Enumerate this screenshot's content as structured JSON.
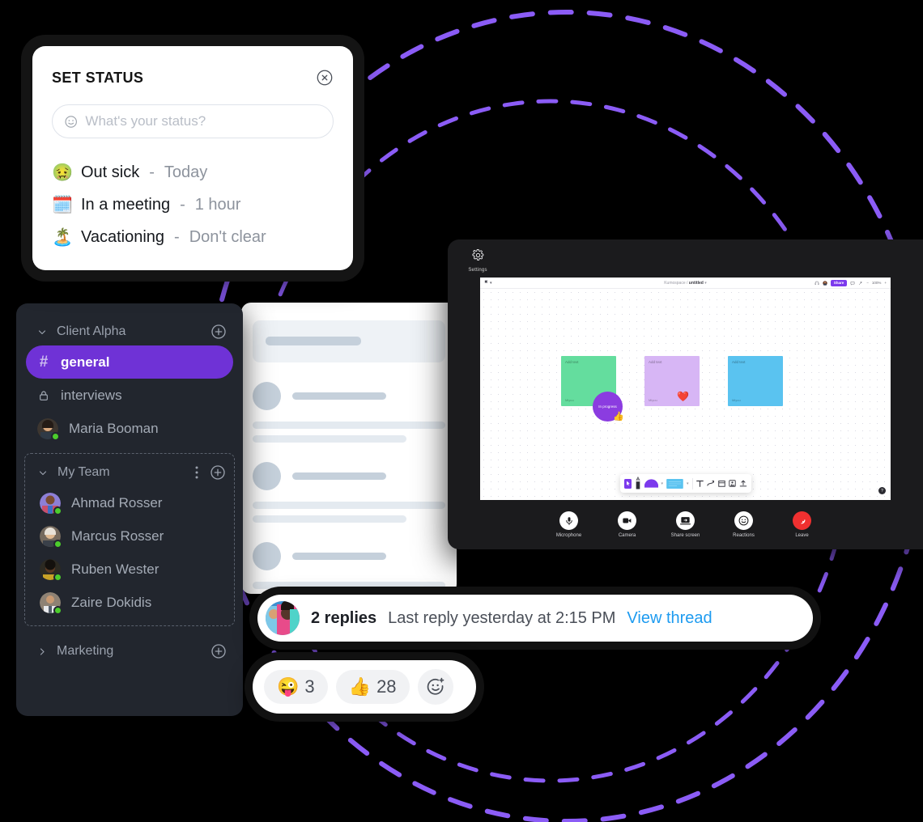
{
  "status_card": {
    "title": "SET STATUS",
    "close_icon": "close-circle-icon",
    "input": {
      "placeholder": "What's your status?",
      "value": "",
      "icon": "smiley-icon"
    },
    "options": [
      {
        "emoji": "🤢",
        "label": "Out sick",
        "dash": "-",
        "duration": "Today"
      },
      {
        "emoji": "🗓️",
        "label": "In a meeting",
        "dash": "-",
        "duration": "1 hour"
      },
      {
        "emoji": "🏝️",
        "label": "Vacationing",
        "dash": "-",
        "duration": "Don't clear"
      }
    ]
  },
  "sidebar": {
    "sections": [
      {
        "name": "Client Alpha",
        "caret": "chevron-down-icon",
        "add_icon": "plus-circle-icon",
        "expanded": true
      },
      {
        "name": "My Team",
        "caret": "chevron-down-icon",
        "add_icon": "plus-circle-icon",
        "menu_icon": "kebab-menu-icon",
        "expanded": true
      },
      {
        "name": "Marketing",
        "caret": "chevron-right-icon",
        "add_icon": "plus-circle-icon",
        "expanded": false
      }
    ],
    "client_alpha_items": [
      {
        "icon": "hash-icon",
        "glyph": "#",
        "label": "general",
        "active": true
      },
      {
        "icon": "lock-icon",
        "glyph": "",
        "label": "interviews",
        "active": false
      },
      {
        "icon": "avatar",
        "glyph": "",
        "label": "Maria Booman",
        "active": false,
        "presence": "online"
      }
    ],
    "my_team_items": [
      {
        "icon": "avatar",
        "label": "Ahmad Rosser",
        "presence": "online"
      },
      {
        "icon": "avatar",
        "label": "Marcus Rosser",
        "presence": "online"
      },
      {
        "icon": "avatar",
        "label": "Ruben Wester",
        "presence": "online"
      },
      {
        "icon": "avatar",
        "label": "Zaire Dokidis",
        "presence": "online"
      }
    ]
  },
  "video_window": {
    "settings_label": "Settings",
    "settings_icon": "gear-icon",
    "controls": [
      {
        "label": "Microphone",
        "icon": "microphone-icon",
        "danger": false
      },
      {
        "label": "Camera",
        "icon": "camera-icon",
        "danger": false
      },
      {
        "label": "Share screen",
        "icon": "share-screen-icon",
        "danger": false
      },
      {
        "label": "Reactions",
        "icon": "smiley-icon",
        "danger": false
      },
      {
        "label": "Leave",
        "icon": "phone-hangup-icon",
        "danger": true
      }
    ]
  },
  "whiteboard": {
    "brand": "Kumospace",
    "separator": "/",
    "file_name": "untitled",
    "share_label": "Share",
    "zoom_level": "100%",
    "zoom_out": "−",
    "zoom_in": "+",
    "header_icons": [
      "headphones-icon",
      "avatar",
      "comment-icon",
      "magic-icon"
    ],
    "notes": [
      {
        "title": "Add text",
        "footer": "Miyuu",
        "color": "#64dd9e"
      },
      {
        "title": "Add text",
        "footer": "Miyuu",
        "color": "#d7b6f5"
      },
      {
        "title": "Add text",
        "footer": "Miyuu",
        "color": "#5ac3f0"
      }
    ],
    "bubble_label": "In progress",
    "reaction_emoji": "❤️",
    "cursor_emoji": "👍",
    "tools": [
      "cursor-icon",
      "pen-icon",
      "shape-icon",
      "sticky-note-icon",
      "text-icon",
      "connector-icon",
      "frame-icon",
      "image-icon",
      "upload-icon"
    ],
    "help_label": "?"
  },
  "thread": {
    "replies_count": "2 replies",
    "meta": "Last reply yesterday at 2:15 PM",
    "link": "View thread",
    "avatar_icon": "avatar"
  },
  "reactions": {
    "items": [
      {
        "emoji": "😜",
        "count": "3"
      },
      {
        "emoji": "👍",
        "count": "28"
      }
    ],
    "add_icon": "add-reaction-icon"
  },
  "colors": {
    "accent_purple": "#6f32d6",
    "brand_purple": "#7c3aed",
    "deco_dash": "#8b5cf6",
    "sidebar_bg": "#22262e",
    "page_bg": "#000000",
    "link_blue": "#1d9bf0",
    "online_green": "#4ccd2c",
    "leave_red": "#f03030"
  }
}
